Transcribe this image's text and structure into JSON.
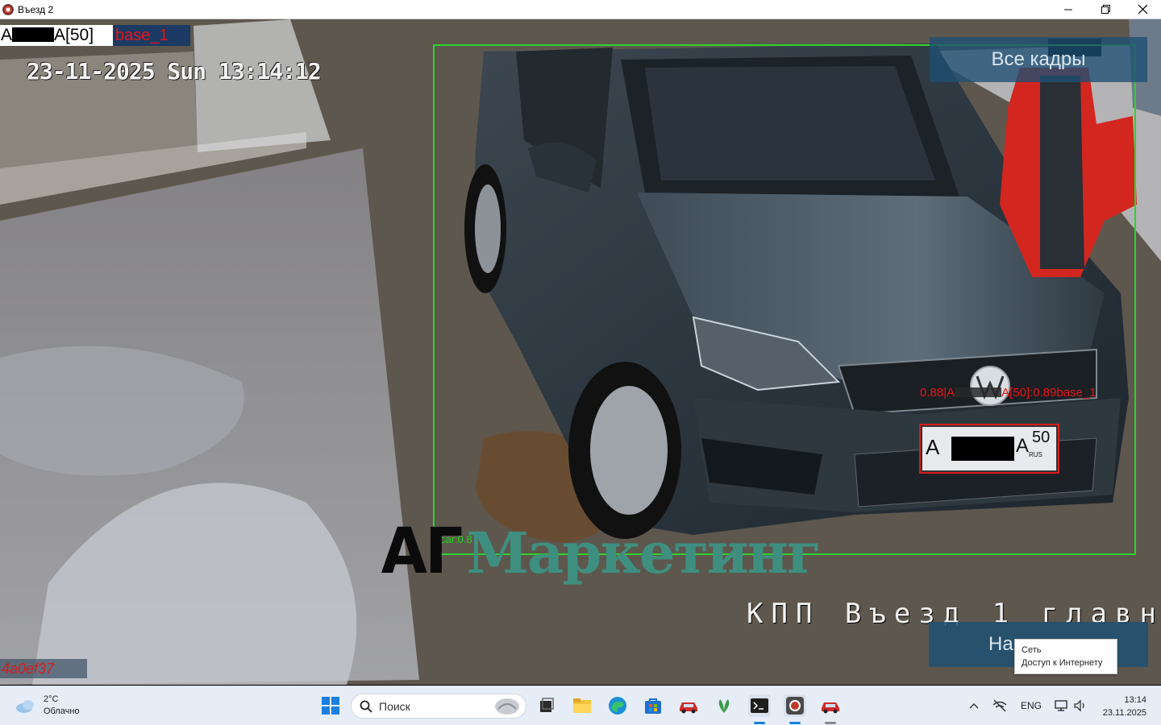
{
  "window": {
    "title": "Въезд 2",
    "icons": [
      "app-camera-icon",
      "minimize-icon",
      "maximize-icon",
      "close-icon"
    ]
  },
  "overlay": {
    "plate_prefix": "A",
    "plate_suffix": "A[50]",
    "base_label": "base_1",
    "timestamp": "23-11-2025 Sun 13:14:12",
    "all_frames_button": "Все кадры",
    "car_score": "car:0.8",
    "plate_score_prefix": "0.88|A",
    "plate_score_suffix": "A[50]:0.89base_1",
    "plate_text_left": "A",
    "plate_text_right": "A",
    "plate_region": "50",
    "plate_country": "RUS",
    "logo_part1": "АГ",
    "logo_part2": "Маркетинг",
    "checkpoint_label": "КПП Въезд 1 главн",
    "next_button": "На",
    "camera_id": "4a0ef37",
    "colors": {
      "detect_box": "#2bd52b",
      "plate_box": "#d61c1c",
      "button_bg": "#1e5073"
    }
  },
  "tooltip": {
    "title": "Сеть",
    "detail": "Доступ к Интернету"
  },
  "taskbar": {
    "weather_temp": "2°C",
    "weather_desc": "Облачно",
    "search_placeholder": "Поиск",
    "language": "ENG",
    "time": "13:14",
    "date": "23.11.2025",
    "icons": [
      "start-icon",
      "search-icon",
      "task-view-icon",
      "file-explorer-icon",
      "edge-icon",
      "store-icon",
      "car-app-icon",
      "leaf-app-icon",
      "terminal-icon",
      "camera-app-icon",
      "car-app-2-icon",
      "chevron-up-icon",
      "network-off-icon",
      "network-icon",
      "volume-icon"
    ]
  }
}
